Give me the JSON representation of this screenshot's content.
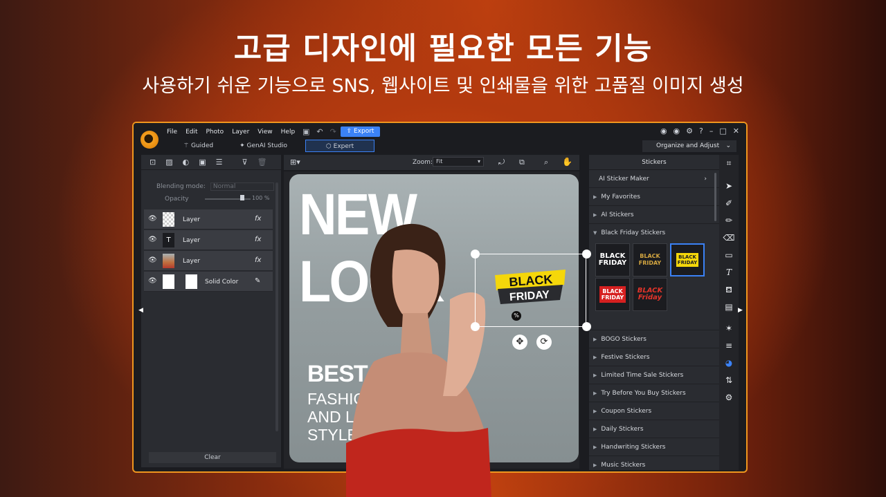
{
  "hero": {
    "title": "고급 디자인에 필요한 모든 기능",
    "subtitle": "사용하기 쉬운 기능으로 SNS, 웹사이트 및 인쇄물을 위한 고품질 이미지 생성"
  },
  "menu": [
    "File",
    "Edit",
    "Photo",
    "Layer",
    "View",
    "Help"
  ],
  "export_label": "Export",
  "mode_tabs": [
    "Guided",
    "GenAI Studio",
    "Expert"
  ],
  "organize_label": "Organize and Adjust",
  "layers_panel": {
    "blending_label": "Blending mode:",
    "blending_value": "Normal",
    "opacity_label": "Opacity",
    "opacity_value": "100 %",
    "layers": [
      {
        "name": "Layer",
        "type": "transparent"
      },
      {
        "name": "Layer",
        "type": "text"
      },
      {
        "name": "Layer",
        "type": "photo"
      },
      {
        "name": "Solid Color",
        "type": "solid"
      }
    ],
    "clear_label": "Clear"
  },
  "canvas": {
    "zoom_label": "Zoom:",
    "zoom_value": "Fit",
    "headline": "NEW LOOK",
    "best": "BEST 10",
    "lines": [
      "FASHION",
      "AND LIFE",
      "STYLE"
    ]
  },
  "sticker": {
    "line1": "BLACK",
    "line2": "FRIDAY"
  },
  "stickers_panel": {
    "title": "Stickers",
    "ai_maker": "AI Sticker Maker",
    "favorites": "My Favorites",
    "ai_stickers": "AI Stickers",
    "black_friday": "Black Friday Stickers",
    "thumbs": [
      [
        "BLACK",
        "FRIDAY"
      ],
      [
        "BLACK",
        "FRIDAY"
      ],
      [
        "BLACK",
        "FRIDAY"
      ],
      [
        "BLACK",
        "FRIDAY"
      ],
      [
        "BLACK",
        "Friday"
      ]
    ],
    "categories": [
      "BOGO Stickers",
      "Festive Stickers",
      "Limited Time Sale Stickers",
      "Try Before You Buy Stickers",
      "Coupon Stickers",
      "Daily Stickers",
      "Handwriting Stickers",
      "Music Stickers"
    ]
  },
  "colors": {
    "accent": "#3b82f6",
    "frame": "#f0961e",
    "sticker_yellow": "#f5d70a"
  }
}
